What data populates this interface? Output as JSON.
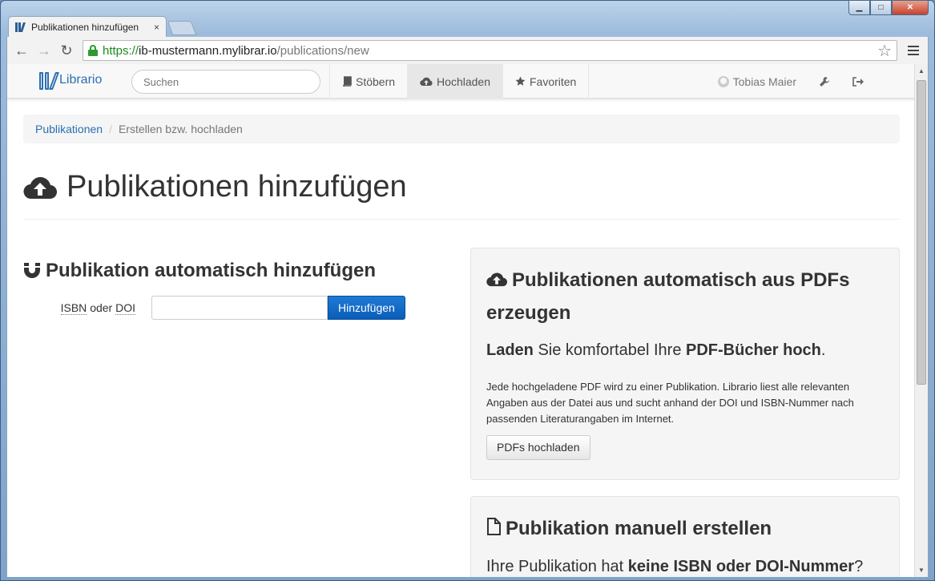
{
  "browser": {
    "tab_title": "Publikationen hinzufügen",
    "tab_close": "×",
    "url_scheme": "https://",
    "url_host": "ib-mustermann.mylibrar.io",
    "url_path": "/publications/new",
    "window_controls": {
      "minimize": "▁",
      "maximize": "□",
      "close": "✕"
    },
    "nav": {
      "back": "←",
      "forward": "→",
      "reload": "↻",
      "bookmark": "☆"
    }
  },
  "app_nav": {
    "brand": "Librario",
    "search_placeholder": "Suchen",
    "links": [
      {
        "label": "Stöbern",
        "icon": "book-icon"
      },
      {
        "label": "Hochladen",
        "icon": "cloud-upload-icon",
        "active": true
      },
      {
        "label": "Favoriten",
        "icon": "star-icon"
      }
    ],
    "user": "Tobias Maier",
    "settings_icon": "🔧",
    "logout_icon": "⇥"
  },
  "breadcrumb": {
    "link": "Publikationen",
    "separator": "/",
    "active": "Erstellen bzw. hochladen"
  },
  "page": {
    "title": "Publikationen hinzufügen"
  },
  "auto_add": {
    "title": "Publikation automatisch hinzufügen",
    "label_isbn": "ISBN",
    "label_oder": "oder",
    "label_doi": "DOI",
    "input_value": "",
    "button": "Hinzufügen"
  },
  "pdf_well": {
    "title": "Publikationen automatisch aus PDFs erzeugen",
    "lead_b1": "Laden",
    "lead_mid": " Sie komfortabel Ihre ",
    "lead_b2": "PDF-Bücher hoch",
    "lead_end": ".",
    "description": "Jede hochgeladene PDF wird zu einer Publikation. Librario liest alle relevanten Angaben aus der Datei aus und sucht anhand der DOI und ISBN-Nummer nach passenden Literaturangaben im Internet.",
    "button": "PDFs hochladen"
  },
  "manual_well": {
    "title": "Publikation manuell erstellen",
    "lead_start": "Ihre Publikation hat ",
    "lead_b": "keine ISBN oder DOI-Nummer",
    "lead_end": "?"
  },
  "colors": {
    "brand": "#2a6fb3",
    "primary_button": "#0a5eb8",
    "url_secure": "#1e8a1e"
  }
}
